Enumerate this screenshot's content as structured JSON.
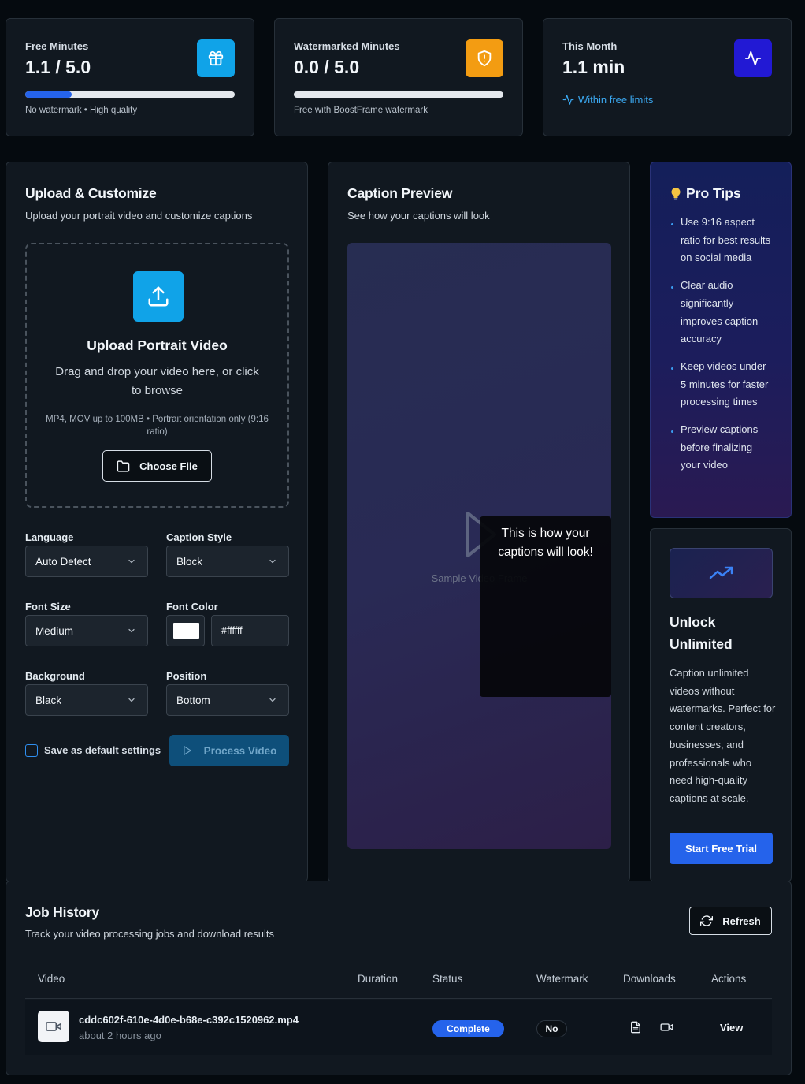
{
  "stats": [
    {
      "label": "Free Minutes",
      "value": "1.1 / 5.0",
      "progress": 0.22,
      "note": "No watermark • High quality",
      "icon": "gift-icon",
      "icon_bg": "#10a3e8"
    },
    {
      "label": "Watermarked Minutes",
      "value": "0.0 / 5.0",
      "progress": 0.0,
      "note": "Free with BoostFrame watermark",
      "icon": "shield-icon",
      "icon_bg": "#f39c12"
    },
    {
      "label": "This Month",
      "value": "1.1 min",
      "status": "Within free limits",
      "icon": "activity-icon",
      "icon_bg": "#2219d4"
    }
  ],
  "upload": {
    "title": "Upload & Customize",
    "subtitle": "Upload your portrait video and customize captions",
    "dropzone_title": "Upload Portrait Video",
    "dropzone_desc": "Drag and drop your video here, or click to browse",
    "dropzone_hint": "MP4, MOV up to 100MB • Portrait orientation only (9:16 ratio)",
    "choose_file": "Choose File",
    "language_label": "Language",
    "language_value": "Auto Detect",
    "caption_style_label": "Caption Style",
    "caption_style_value": "Block",
    "font_size_label": "Font Size",
    "font_size_value": "Medium",
    "font_color_label": "Font Color",
    "font_color_value": "#ffffff",
    "background_label": "Background",
    "background_value": "Black",
    "position_label": "Position",
    "position_value": "Bottom",
    "save_default_label": "Save as default settings",
    "save_default_checked": false,
    "process_button": "Process Video"
  },
  "preview": {
    "title": "Caption Preview",
    "subtitle": "See how your captions will look",
    "sample_frame": "Sample Video Frame",
    "caption_text": "This is how your captions will look!"
  },
  "tips": {
    "title": "Pro Tips",
    "items": [
      "Use 9:16 aspect ratio for best results on social media",
      "Clear audio significantly improves caption accuracy",
      "Keep videos under 5 minutes for faster processing times",
      "Preview captions before finalizing your video"
    ]
  },
  "unlock": {
    "title": "Unlock Unlimited",
    "description": "Caption unlimited videos without watermarks. Perfect for content creators, businesses, and professionals who need high-quality captions at scale.",
    "button": "Start Free Trial"
  },
  "jobs": {
    "title": "Job History",
    "subtitle": "Track your video processing jobs and download results",
    "refresh": "Refresh",
    "columns": [
      "Video",
      "Duration",
      "Status",
      "Watermark",
      "Downloads",
      "Actions"
    ],
    "rows": [
      {
        "filename": "cddc602f-610e-4d0e-b68e-c392c1520962.mp4",
        "time": "about 2 hours ago",
        "duration": "",
        "status": "Complete",
        "watermark": "No",
        "action": "View"
      }
    ]
  }
}
